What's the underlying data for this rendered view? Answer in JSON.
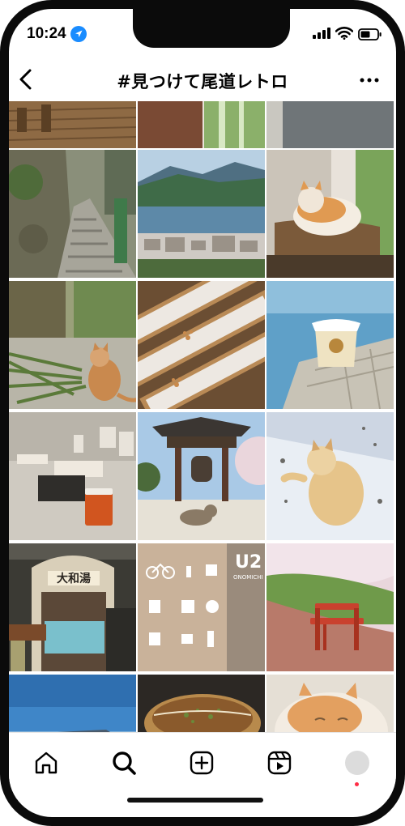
{
  "status": {
    "time": "10:24"
  },
  "header": {
    "title": "#見つけて尾道レトロ"
  },
  "icons": {
    "back": "chevron-left-icon",
    "more": "ellipsis-icon",
    "location": "location-arrow-icon",
    "signal": "cellular-signal-icon",
    "wifi": "wifi-icon",
    "battery": "battery-icon"
  },
  "grid": {
    "tiles": [
      {
        "subject": "wooden boardwalk"
      },
      {
        "subject": "brown signboard"
      },
      {
        "subject": "bamboo grove"
      },
      {
        "subject": "street pavement"
      },
      {
        "subject": "stone stairway"
      },
      {
        "subject": "harbour view"
      },
      {
        "subject": "cat on blanket"
      },
      {
        "subject": "cat with bamboo"
      },
      {
        "subject": "pawprint boards"
      },
      {
        "subject": "cup by the sea"
      },
      {
        "subject": "shop counter"
      },
      {
        "subject": "temple bell tower"
      },
      {
        "subject": "cat in snow"
      },
      {
        "subject": "bathhouse storefront"
      },
      {
        "subject": "cycle hotel wall"
      },
      {
        "subject": "red bench"
      },
      {
        "subject": "blue sky"
      },
      {
        "subject": "okonomiyaki"
      },
      {
        "subject": "sleeping cat"
      }
    ]
  },
  "storefront": {
    "sign": "大和湯",
    "wall_brand": "U2",
    "wall_subtitle": "ONOMICHI"
  },
  "tab_bar": {
    "items": [
      "home-icon",
      "search-icon",
      "new-post-icon",
      "reels-icon",
      "profile-avatar"
    ],
    "active": "search-icon"
  },
  "colors": {
    "notification_dot": "#ff2d46",
    "accent": "#000000"
  }
}
